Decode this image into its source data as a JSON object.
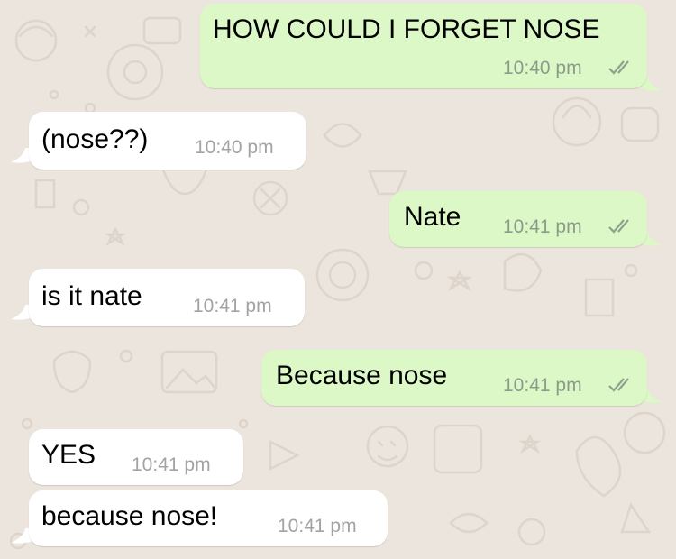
{
  "colors": {
    "background": "#ece5dd",
    "incoming_bubble": "#ffffff",
    "outgoing_bubble": "#dcf8c6",
    "timestamp": "#8c9a8c",
    "read_ticks": "#8fa08f"
  },
  "messages": [
    {
      "direction": "outgoing",
      "text": "HOW COULD I FORGET NOSE",
      "time": "10:40 pm",
      "status": "read-ticks-icon"
    },
    {
      "direction": "incoming",
      "text": "(nose??)",
      "time": "10:40 pm"
    },
    {
      "direction": "outgoing",
      "text": "Nate",
      "time": "10:41 pm",
      "status": "read-ticks-icon"
    },
    {
      "direction": "incoming",
      "text": "is it nate",
      "time": "10:41 pm"
    },
    {
      "direction": "outgoing",
      "text": "Because nose",
      "time": "10:41 pm",
      "status": "read-ticks-icon"
    },
    {
      "direction": "incoming",
      "text": "YES",
      "time": "10:41 pm"
    },
    {
      "direction": "incoming",
      "text": "because nose!",
      "time": "10:41 pm"
    }
  ]
}
